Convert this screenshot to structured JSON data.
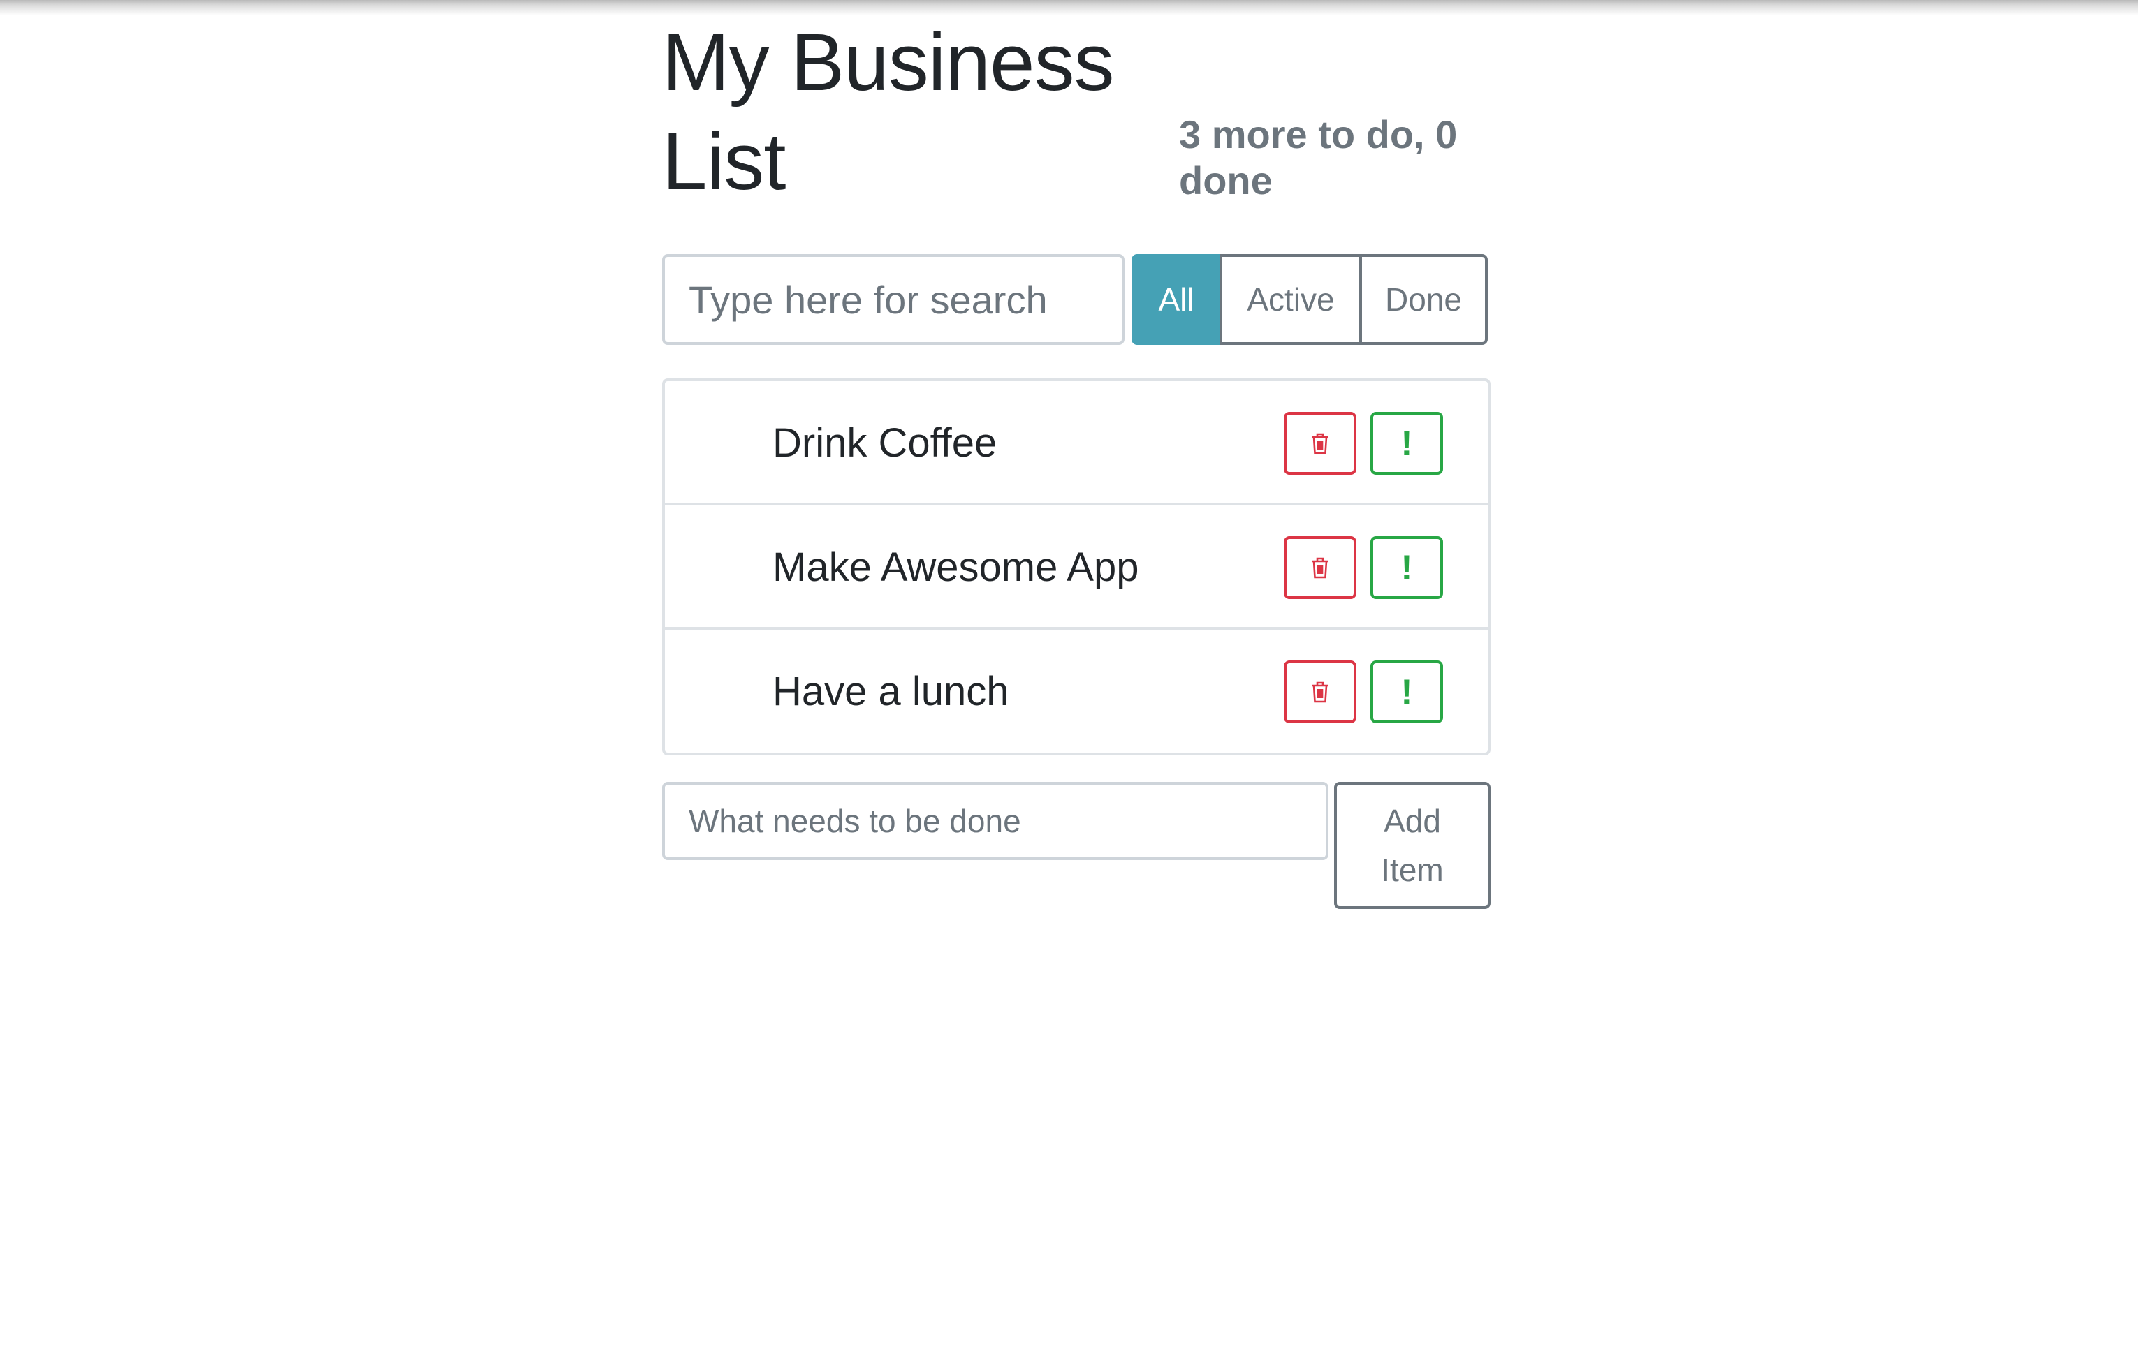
{
  "header": {
    "title": "My Business List",
    "status": "3 more to do, 0 done"
  },
  "search": {
    "placeholder": "Type here for search",
    "value": ""
  },
  "filters": {
    "all_label": "All",
    "active_label": "Active",
    "done_label": "Done",
    "selected": "All"
  },
  "items": [
    {
      "label": "Drink Coffee",
      "delete_icon": "trash-icon",
      "important_icon": "exclamation-icon"
    },
    {
      "label": "Make Awesome App",
      "delete_icon": "trash-icon",
      "important_icon": "exclamation-icon"
    },
    {
      "label": "Have a lunch",
      "delete_icon": "trash-icon",
      "important_icon": "exclamation-icon"
    }
  ],
  "important_glyph": "!",
  "add_form": {
    "placeholder": "What needs to be done",
    "value": "",
    "button_label": "Add Item"
  },
  "colors": {
    "filter_selected": "#45a1b5",
    "delete": "#dc3545",
    "important": "#28a745",
    "secondary": "#6c757d"
  }
}
